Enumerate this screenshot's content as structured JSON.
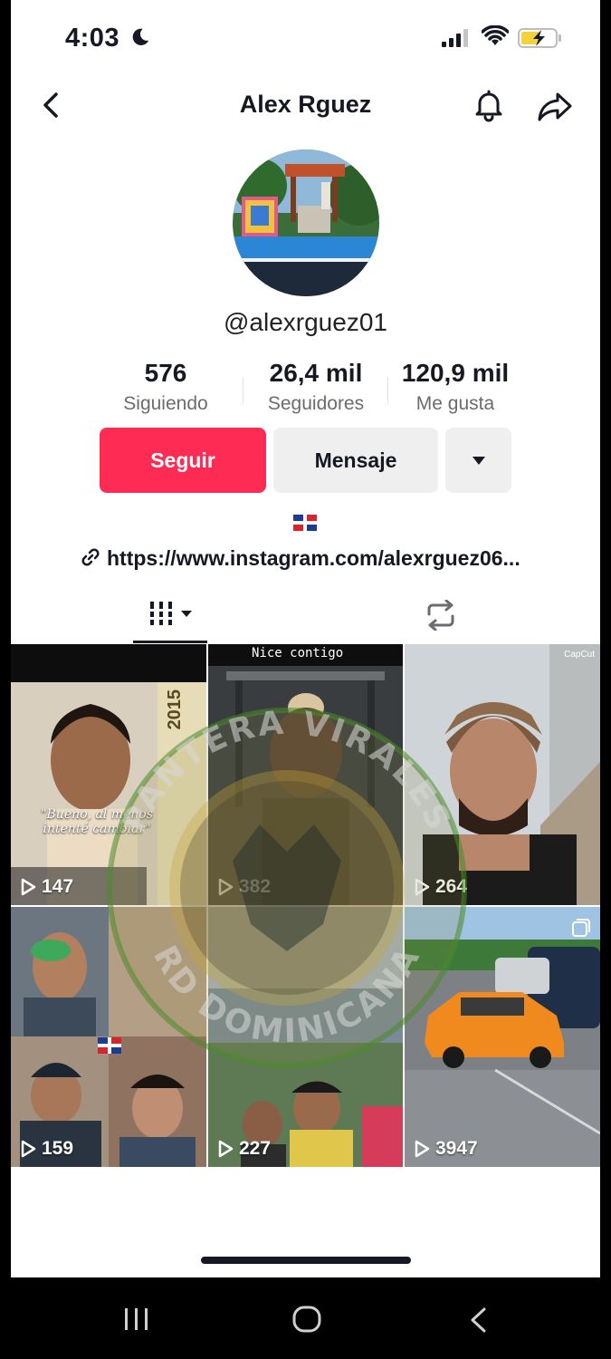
{
  "status_bar": {
    "time": "4:03"
  },
  "header": {
    "title": "Alex Rguez"
  },
  "profile": {
    "handle": "@alexrguez01",
    "stats": [
      {
        "value": "576",
        "label": "Siguiendo"
      },
      {
        "value": "26,4 mil",
        "label": "Seguidores"
      },
      {
        "value": "120,9 mil",
        "label": "Me gusta"
      }
    ],
    "follow_label": "Seguir",
    "message_label": "Mensaje",
    "link": "https://www.instagram.com/alexrguez06..."
  },
  "videos": [
    {
      "views": "147",
      "caption": "\"Bueno, al menos intenté cambiar\"",
      "side_text": "2015"
    },
    {
      "views": "382",
      "caption": "Nice contigo"
    },
    {
      "views": "264",
      "badge": "CapCut"
    },
    {
      "views": "159"
    },
    {
      "views": "227"
    },
    {
      "views": "3947"
    }
  ],
  "watermark_text": {
    "top": "PANTERA VIRALES",
    "bottom": "RD DOMINICANA"
  },
  "colors": {
    "accent": "#fe2c55",
    "text": "#161823",
    "muted": "#6b6b70",
    "button_bg": "#efeff0"
  }
}
